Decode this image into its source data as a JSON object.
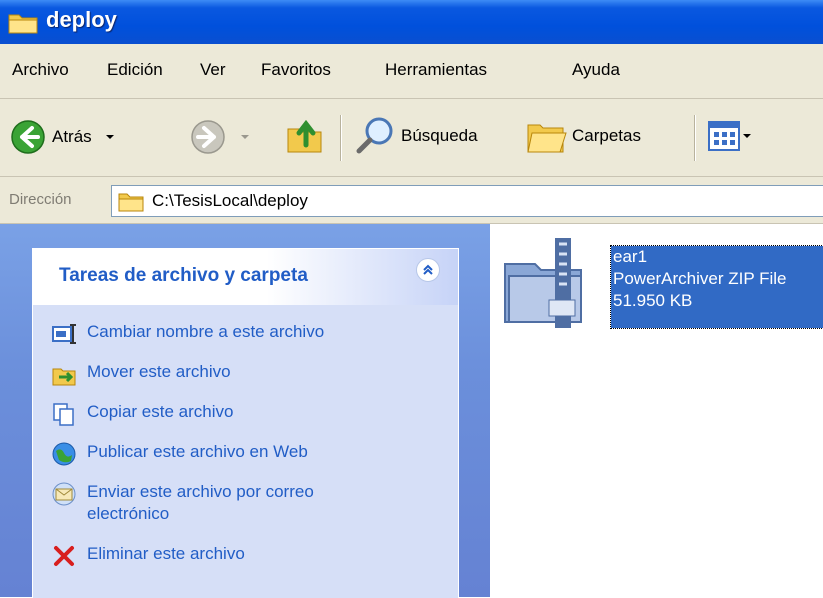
{
  "window": {
    "title": "deploy"
  },
  "menu": [
    "Archivo",
    "Edición",
    "Ver",
    "Favoritos",
    "Herramientas",
    "Ayuda"
  ],
  "toolbar": {
    "back_label": "Atrás",
    "search_label": "Búsqueda",
    "folders_label": "Carpetas"
  },
  "address": {
    "label": "Dirección",
    "path": "C:\\TesisLocal\\deploy"
  },
  "tasks_panel": {
    "title": "Tareas de archivo y carpeta",
    "items": [
      {
        "label": "Cambiar nombre a este archivo",
        "icon": "rename-icon"
      },
      {
        "label": "Mover este archivo",
        "icon": "move-icon"
      },
      {
        "label": "Copiar este archivo",
        "icon": "copy-icon"
      },
      {
        "label": "Publicar este archivo en Web",
        "icon": "publish-web-icon"
      },
      {
        "label": "Enviar este archivo por correo electrónico",
        "icon": "email-icon"
      },
      {
        "label": "Eliminar este archivo",
        "icon": "delete-icon"
      }
    ]
  },
  "file": {
    "name": "ear1",
    "type": "PowerArchiver ZIP File",
    "size": "51.950 KB",
    "icon": "zip-archive-icon"
  },
  "colors": {
    "titlebar": "#0050dc",
    "panel_title": "#215dc6",
    "selection": "#316ac5"
  }
}
